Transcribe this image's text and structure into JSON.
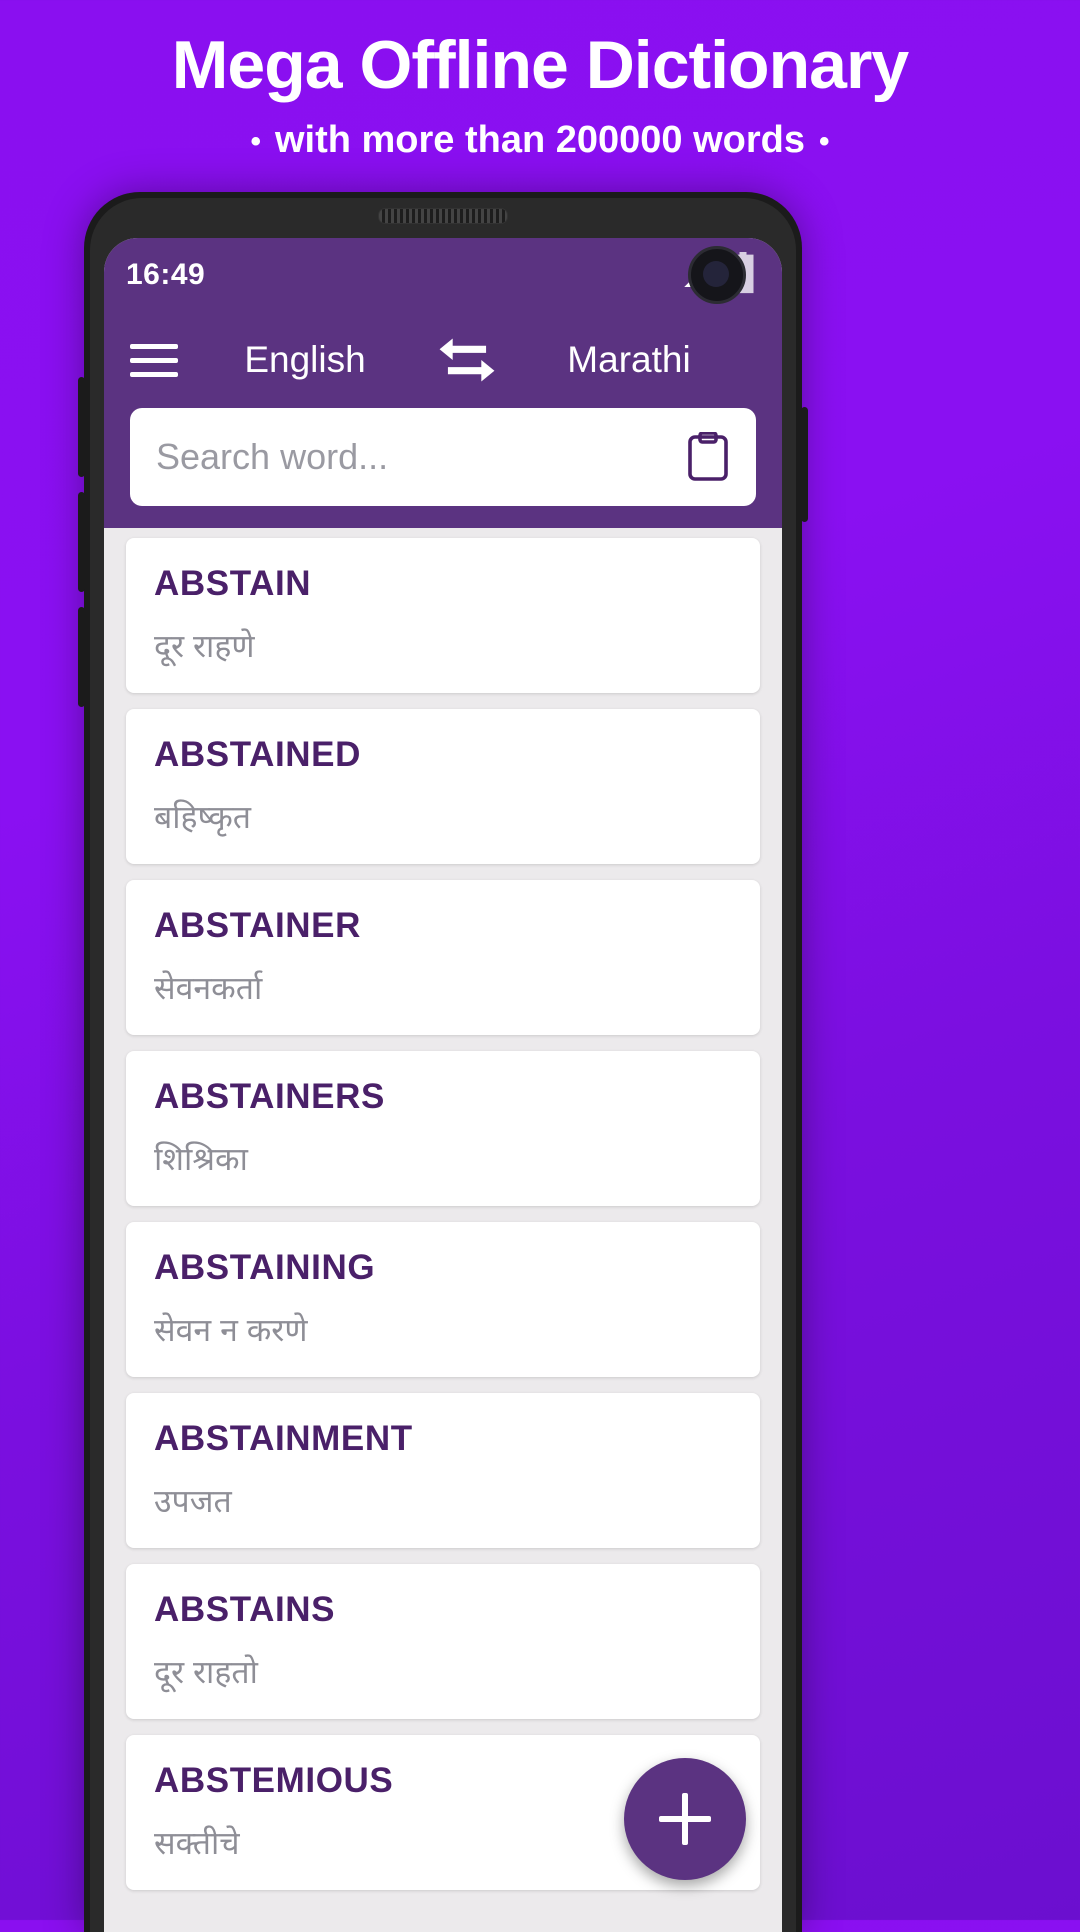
{
  "promo": {
    "title": "Mega Offline Dictionary",
    "subtitle": "with more than 200000 words",
    "bullet": "•"
  },
  "status_bar": {
    "time": "16:49",
    "icons": [
      "signal-no-sim-icon",
      "battery-icon",
      "front-camera"
    ]
  },
  "app_bar": {
    "menu_icon": "hamburger-menu-icon",
    "source_language": "English",
    "swap_icon": "swap-arrows-icon",
    "target_language": "Marathi"
  },
  "search": {
    "placeholder": "Search word...",
    "value": "",
    "paste_icon": "clipboard-icon"
  },
  "fab": {
    "icon": "plus-icon",
    "label": "+"
  },
  "word_list": [
    {
      "word": "ABSTAIN",
      "meaning": "दूर राहणे"
    },
    {
      "word": "ABSTAINED",
      "meaning": "बहिष्कृत"
    },
    {
      "word": "ABSTAINER",
      "meaning": "सेवनकर्ता"
    },
    {
      "word": "ABSTAINERS",
      "meaning": "शिश्रिका"
    },
    {
      "word": "ABSTAINING",
      "meaning": "सेवन न करणे"
    },
    {
      "word": "ABSTAINMENT",
      "meaning": "उपजत"
    },
    {
      "word": "ABSTAINS",
      "meaning": "दूर राहतो"
    },
    {
      "word": "ABSTEMIOUS",
      "meaning": "सक्तीचे"
    }
  ],
  "colors": {
    "brand_purple": "#5b3381",
    "word_purple": "#4a2069",
    "meaning_gray": "#8e8e96",
    "page_bg_purple": "#8a10f2",
    "card_white": "#ffffff",
    "list_bg": "#eceaec"
  }
}
